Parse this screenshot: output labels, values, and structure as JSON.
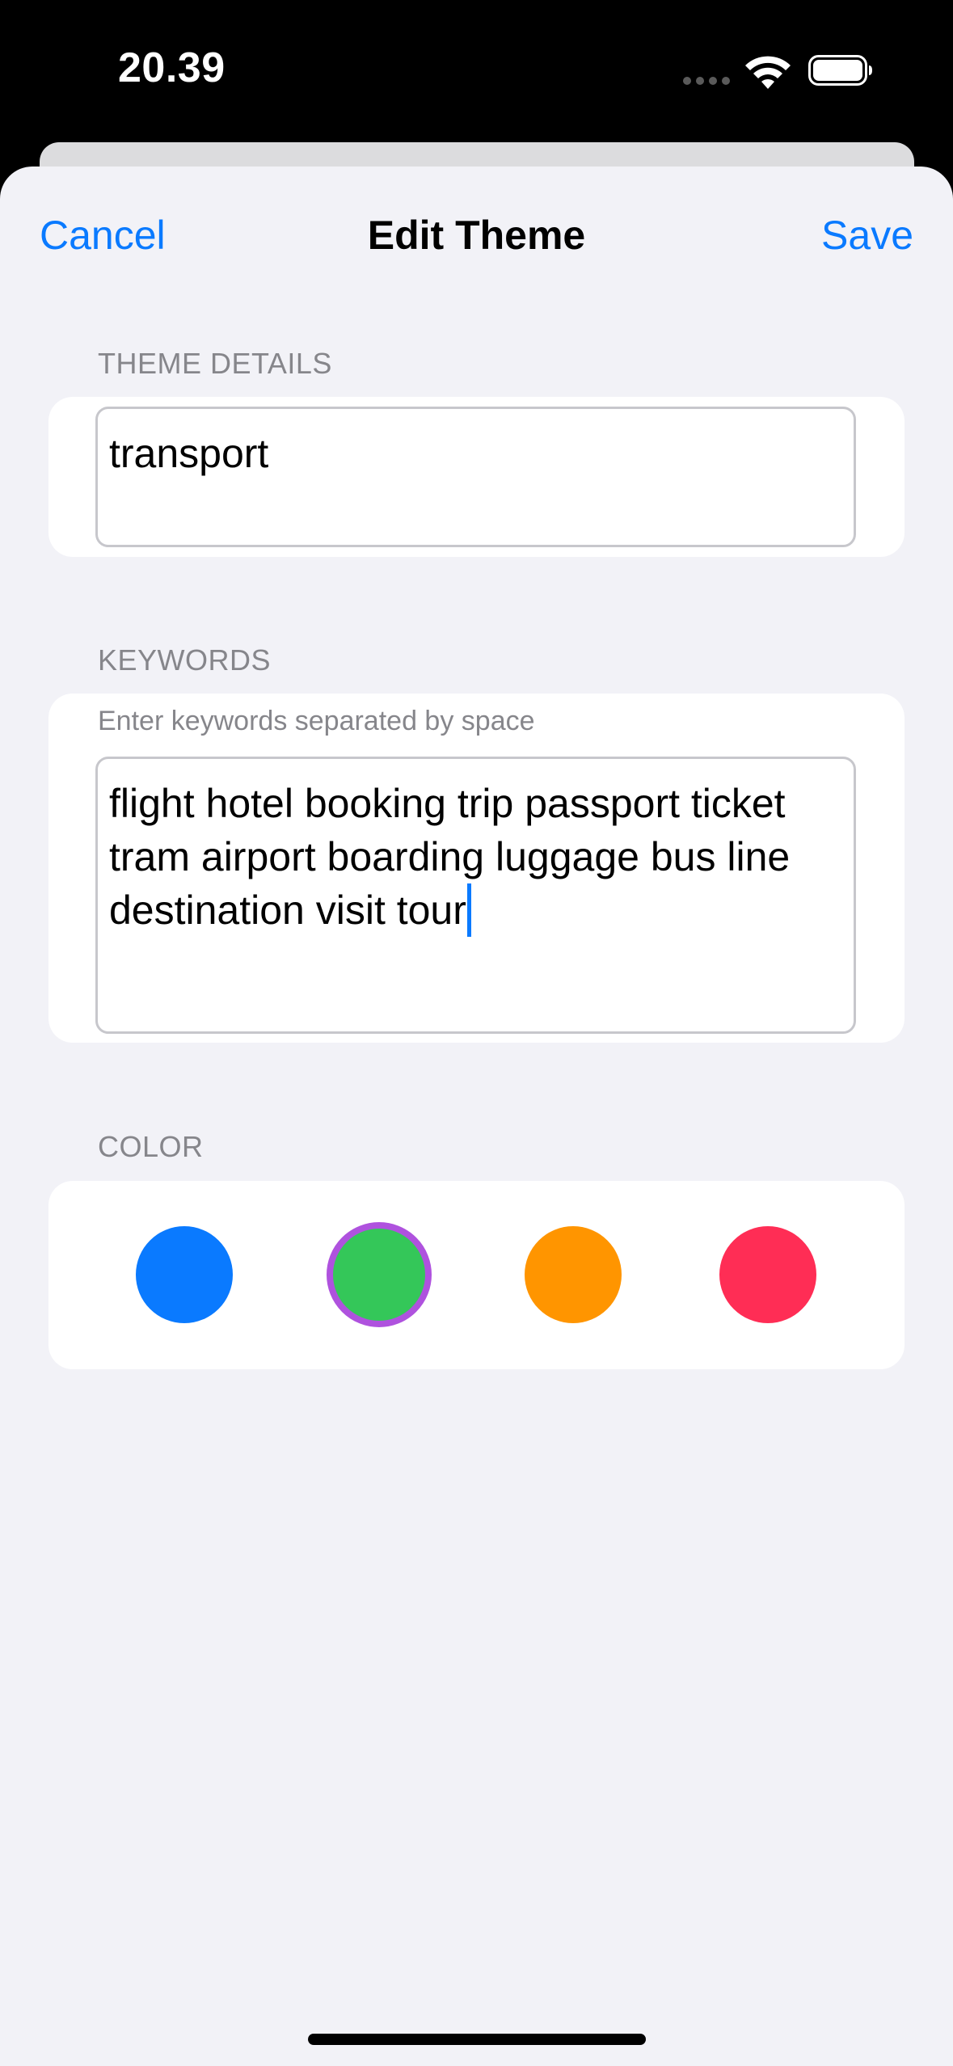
{
  "status_bar": {
    "time": "20.39",
    "signal_icon": "cellular-signal-icon",
    "wifi_icon": "wifi-icon",
    "battery_icon": "battery-full-icon"
  },
  "nav": {
    "cancel_label": "Cancel",
    "title": "Edit Theme",
    "save_label": "Save",
    "accent_color": "#0a7aff"
  },
  "sections": {
    "theme_details": {
      "header": "THEME DETAILS",
      "name_value": "transport"
    },
    "keywords": {
      "header": "KEYWORDS",
      "hint": "Enter keywords separated by space",
      "value": "flight hotel booking trip passport ticket tram airport boarding luggage bus line destination visit tour"
    },
    "color": {
      "header": "COLOR",
      "options": [
        {
          "name": "blue",
          "hex": "#0a7aff",
          "selected": false
        },
        {
          "name": "green",
          "hex": "#34c759",
          "selected": true
        },
        {
          "name": "orange",
          "hex": "#ff9500",
          "selected": false
        },
        {
          "name": "red",
          "hex": "#ff2d55",
          "selected": false
        }
      ],
      "selection_ring_color": "#af52de"
    }
  }
}
